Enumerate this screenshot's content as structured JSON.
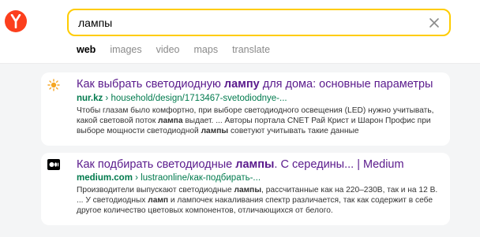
{
  "search": {
    "query": "лампы"
  },
  "tabs": [
    {
      "label": "web",
      "active": true
    },
    {
      "label": "images",
      "active": false
    },
    {
      "label": "video",
      "active": false
    },
    {
      "label": "maps",
      "active": false
    },
    {
      "label": "translate",
      "active": false
    }
  ],
  "colors": {
    "logo": "#fc3f1d",
    "search_border": "#ffcc00",
    "title_link": "#5a1a8c",
    "url": "#007a4d"
  },
  "results": [
    {
      "favicon": "sun-icon",
      "title_pre": "Как выбрать светодиодную ",
      "title_bold": "лампу",
      "title_post": " для дома: основные параметры",
      "domain": "nur.kz",
      "path": " › household/design/1713467-svetodiodnye-...",
      "snippet": [
        {
          "t": "Чтобы глазам было комфортно, при выборе светодиодного освещения (LED) нужно учитывать, какой световой поток ",
          "b": false
        },
        {
          "t": "лампа",
          "b": true
        },
        {
          "t": " выдает. ... Авторы портала CNET Рай Крист и Шарон Профис при выборе мощности светодиодной ",
          "b": false
        },
        {
          "t": "лампы",
          "b": true
        },
        {
          "t": " советуют учитывать такие данные",
          "b": false
        }
      ]
    },
    {
      "favicon": "medium-icon",
      "title_pre": "Как подбирать светодиодные ",
      "title_bold": "лампы",
      "title_post": ". С середины... | Medium",
      "domain": "medium.com",
      "path": " › lustraonline/как-подбирать-...",
      "snippet": [
        {
          "t": "Производители выпускают светодиодные ",
          "b": false
        },
        {
          "t": "лампы",
          "b": true
        },
        {
          "t": ", рассчитанные как на 220–230В, так и на 12 В. ... У светодиодных ",
          "b": false
        },
        {
          "t": "ламп",
          "b": true
        },
        {
          "t": " и лампочек накаливания спектр различается, так как содержит в себе другое количество цветовых компонентов, отличающихся от белого.",
          "b": false
        }
      ]
    }
  ]
}
